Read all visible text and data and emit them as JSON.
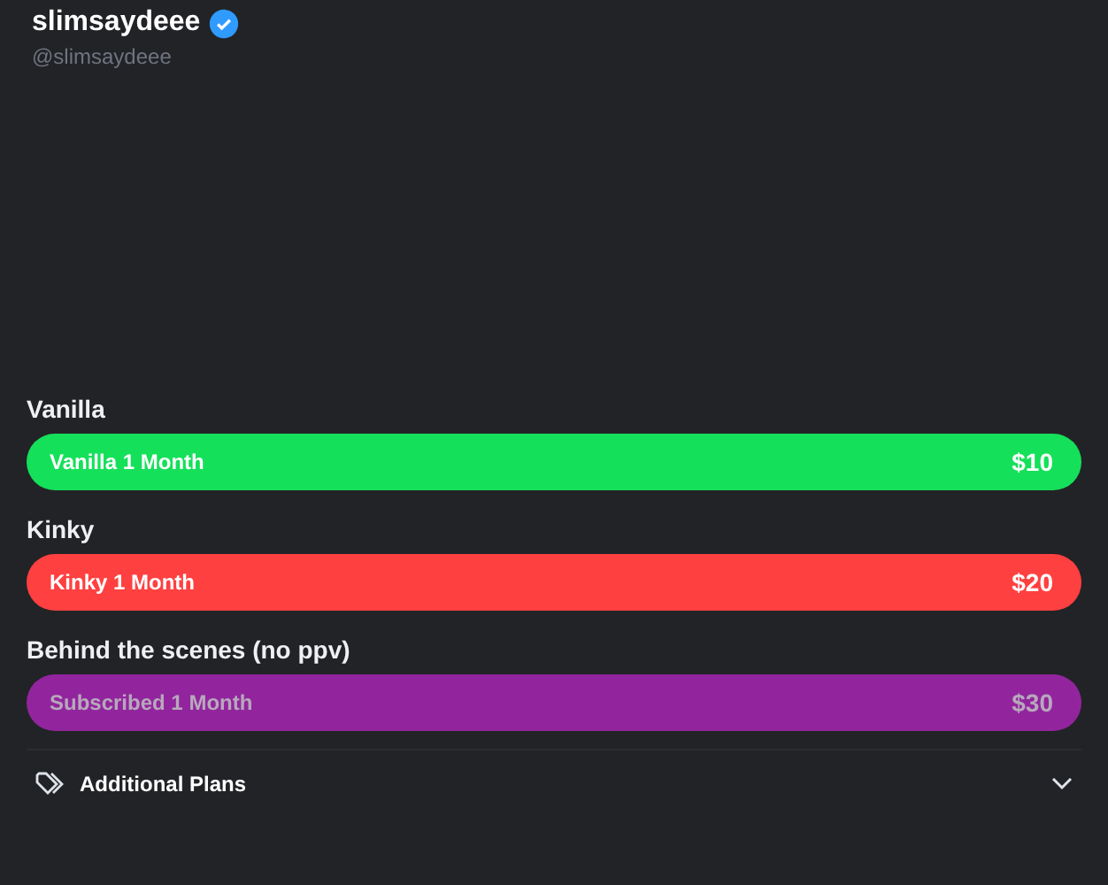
{
  "profile": {
    "name": "slimsaydeee",
    "verified": true,
    "handle": "@slimsaydeee"
  },
  "plans": [
    {
      "heading": "Vanilla",
      "label": "Vanilla 1 Month",
      "price": "$10",
      "color": "#15e05a",
      "subscribed": false
    },
    {
      "heading": "Kinky",
      "label": "Kinky 1 Month",
      "price": "$20",
      "color": "#ff4040",
      "subscribed": false
    },
    {
      "heading": "Behind the scenes (no ppv)",
      "label": "Subscribed 1 Month",
      "price": "$30",
      "color": "#92259e",
      "subscribed": true
    }
  ],
  "additional": {
    "label": "Additional Plans",
    "expanded": false
  }
}
